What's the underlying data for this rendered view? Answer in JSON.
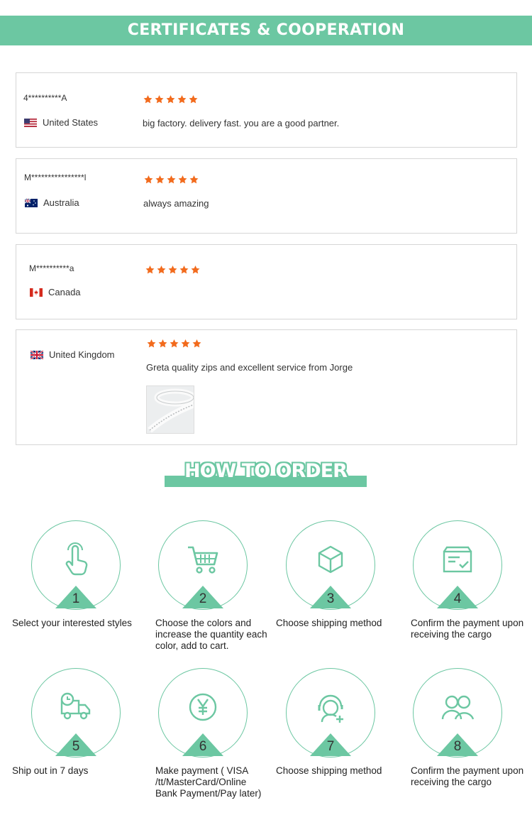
{
  "header": {
    "title": "CERTIFICATES & COOPERATION"
  },
  "reviews": [
    {
      "name": "4**********A",
      "country": "United States",
      "flag": "us",
      "rating": 5,
      "text": "big factory. delivery fast. you are a good partner."
    },
    {
      "name": "M****************l",
      "country": "Australia",
      "flag": "au",
      "rating": 5,
      "text": "always amazing"
    },
    {
      "name": "M**********a",
      "country": "Canada",
      "flag": "ca",
      "rating": 5,
      "text": ""
    },
    {
      "name": "",
      "country": "United Kingdom",
      "flag": "uk",
      "rating": 5,
      "text": "Greta quality zips and excellent service from Jorge",
      "has_photo": true
    }
  ],
  "how_to_order": {
    "title": "HOW TO ORDER",
    "steps": [
      {
        "number": "1",
        "icon": "touch-hand-icon",
        "label": "Select your interested styles"
      },
      {
        "number": "2",
        "icon": "shopping-cart-icon",
        "label": "Choose the colors and increase the quantity each color, add to cart."
      },
      {
        "number": "3",
        "icon": "box-icon",
        "label": "Choose shipping method"
      },
      {
        "number": "4",
        "icon": "payment-box-icon",
        "label": "Confirm the payment upon receiving the cargo"
      },
      {
        "number": "5",
        "icon": "delivery-truck-icon",
        "label": "Ship out in 7 days"
      },
      {
        "number": "6",
        "icon": "yen-coin-icon",
        "label": "Make payment ( VISA /tt/MasterCard/Online Bank Payment/Pay later)"
      },
      {
        "number": "7",
        "icon": "customer-service-icon",
        "label": "Choose shipping method"
      },
      {
        "number": "8",
        "icon": "users-icon",
        "label": "Confirm the payment upon receiving the cargo"
      }
    ]
  },
  "colors": {
    "accent": "#6cc7a2",
    "star": "#f26b1d",
    "border": "#d6d6d6"
  }
}
